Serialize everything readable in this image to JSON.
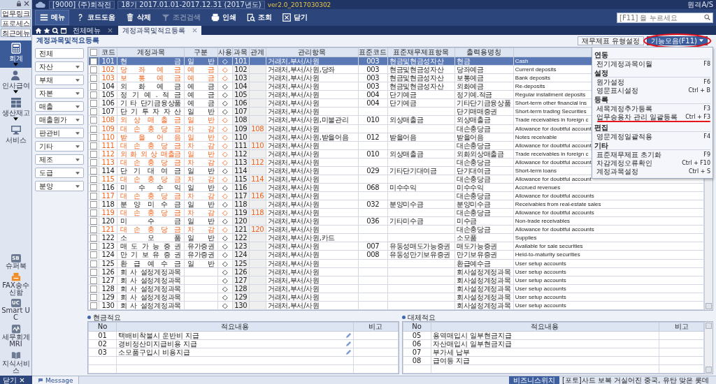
{
  "title_bar": {
    "company": "[9000] (주)회작전",
    "period": "18기 2017.01.01-2017.12.31 (2017년도)",
    "version": "ver2.0_2017030302",
    "remote": "원격A/S"
  },
  "search": {
    "placeholder": "[F11] 을 누르세요"
  },
  "sidebar": {
    "top_buttons": [
      "업무링크",
      "프로세스",
      "최근메뉴"
    ],
    "modules": [
      {
        "kind": "calculator",
        "label": "회계",
        "selected": true,
        "expandable": true
      },
      {
        "kind": "person",
        "label": "인사급여",
        "selected": false,
        "expandable": true
      },
      {
        "kind": "grid",
        "label": "생산재고",
        "selected": false,
        "expandable": true
      },
      {
        "kind": "monitor",
        "label": "서비스",
        "selected": false,
        "expandable": false
      }
    ],
    "shortcuts": [
      {
        "kind": "badge",
        "badge": "SB",
        "label": "슈퍼북"
      },
      {
        "kind": "fax",
        "label": "FAX송수신함"
      },
      {
        "kind": "badge",
        "badge": "UC",
        "label": "Smart UC"
      },
      {
        "kind": "chart",
        "label": "세무회계MRI"
      },
      {
        "kind": "book",
        "label": "지식서비스"
      }
    ],
    "close": "닫기"
  },
  "toolbar": [
    {
      "kind": "menu",
      "label": "메뉴",
      "disabled": false
    },
    {
      "kind": "help",
      "label": "코드도움",
      "disabled": false
    },
    {
      "kind": "delete",
      "label": "삭제",
      "disabled": false
    },
    {
      "kind": "filter",
      "label": "조건검색",
      "disabled": true
    },
    {
      "kind": "print",
      "label": "인쇄",
      "disabled": false
    },
    {
      "kind": "search",
      "label": "조회",
      "disabled": false
    },
    {
      "kind": "close",
      "label": "닫기",
      "disabled": false
    }
  ],
  "tabs": [
    {
      "label": "전체메뉴",
      "selected": false
    },
    {
      "label": "계정과목및적요등록",
      "selected": true
    }
  ],
  "page_title": "계정과목및적요등록",
  "actions": {
    "type_setting": "재무제표 유형설정",
    "functions": "기능모음(F11)",
    "circled": true
  },
  "categories": [
    {
      "label": "전체",
      "expandable": false
    },
    {
      "label": "자산",
      "expandable": true
    },
    {
      "label": "부채",
      "expandable": true
    },
    {
      "label": "자본",
      "expandable": true
    },
    {
      "label": "매출",
      "expandable": true
    },
    {
      "label": "매출원가",
      "expandable": true
    },
    {
      "label": "판관비",
      "expandable": true
    },
    {
      "label": "기타",
      "expandable": true
    },
    {
      "label": "제조",
      "expandable": true
    },
    {
      "label": "도급",
      "expandable": true
    },
    {
      "label": "분양",
      "expandable": true
    }
  ],
  "function_menu": {
    "sections": [
      {
        "title": "연동",
        "items": [
          {
            "label": "전기계정과목이월",
            "shortcut": "F8",
            "marked": false
          }
        ]
      },
      {
        "title": "설정",
        "items": [
          {
            "label": "원가설정",
            "shortcut": "F6",
            "marked": false
          },
          {
            "label": "영문표시설정",
            "shortcut": "Ctrl + B",
            "marked": false
          }
        ]
      },
      {
        "title": "등록",
        "items": [
          {
            "label": "세목계정추가등록",
            "shortcut": "F3",
            "marked": false
          },
          {
            "label": "업무승용차 관리 일괄등록",
            "shortcut": "Ctrl + F3",
            "marked": true
          }
        ]
      },
      {
        "title": "편집",
        "items": [
          {
            "label": "영문계정일괄적용",
            "shortcut": "F4",
            "marked": false
          }
        ]
      },
      {
        "title": "기타",
        "items": [
          {
            "label": "표준재무제표 초기화",
            "shortcut": "F9",
            "marked": false
          },
          {
            "label": "차감계정오류확인",
            "shortcut": "Ctrl + F10",
            "marked": false
          },
          {
            "label": "계정과목설정",
            "shortcut": "Ctrl + S",
            "marked": false
          }
        ]
      }
    ]
  },
  "table": {
    "all_checked": false,
    "columns": [
      "코드",
      "계정과목",
      "구분",
      "사용",
      "과목",
      "관계",
      "관리항목",
      "표준코드",
      "표준재무제표항목",
      "출력용명칭"
    ],
    "rows": [
      {
        "code": "101",
        "name": "현 금",
        "type": "일 반",
        "use": "◇",
        "subject": "101",
        "mgmt": "거래처,부서/사원",
        "std_code": "003",
        "std_item": "현금및현금성자산",
        "print_name": "현금",
        "english": "Cash",
        "highlighted": false,
        "checked": false,
        "selected": true
      },
      {
        "code": "102",
        "name": "당 좌 예 금",
        "type": "예 금",
        "use": "◇",
        "subject": "102",
        "mgmt": "거래처,부서/사원,당좌",
        "std_code": "003",
        "std_item": "현금및현금성자산",
        "print_name": "당좌예금",
        "english": "Current deposits",
        "highlighted": true,
        "checked": false,
        "selected": false
      },
      {
        "code": "103",
        "name": "보 통 예 금",
        "type": "예 금",
        "use": "◇",
        "subject": "103",
        "mgmt": "거래처,부서/사원",
        "std_code": "003",
        "std_item": "현금및현금성자산",
        "print_name": "보통예금",
        "english": "Bank deposits",
        "highlighted": true,
        "checked": false,
        "selected": false
      },
      {
        "code": "104",
        "name": "외 화 예 금",
        "type": "예 금",
        "use": "◇",
        "subject": "104",
        "mgmt": "거래처,부서/사원",
        "std_code": "003",
        "std_item": "현금및현금성자산",
        "print_name": "외화예금",
        "english": "Re-deposits",
        "highlighted": false,
        "checked": false,
        "selected": false
      },
      {
        "code": "105",
        "name": "정 기 예 . 적 금",
        "type": "예 금",
        "use": "◇",
        "subject": "105",
        "mgmt": "거래처,부서/사원",
        "std_code": "004",
        "std_item": "단기예금",
        "print_name": "정기예.적금",
        "english": "Regular installment deposits",
        "highlighted": false,
        "checked": false,
        "selected": false
      },
      {
        "code": "106",
        "name": "기 타 단기금융상품",
        "type": "예 금",
        "use": "◇",
        "subject": "106",
        "mgmt": "거래처,부서/사원",
        "std_code": "004",
        "std_item": "단기예금",
        "print_name": "기타단기금융상품",
        "english": "Short-term other financial ins",
        "highlighted": false,
        "checked": false,
        "selected": false
      },
      {
        "code": "107",
        "name": "단 기 투 자 자 산",
        "type": "일 반",
        "use": "◇",
        "subject": "107",
        "mgmt": "거래처,부서/사원",
        "print_name": "단기매매증권",
        "english": "Short-term trading Securities",
        "highlighted": false,
        "checked": false,
        "selected": false
      },
      {
        "code": "108",
        "name": "외 상 매 출 금",
        "type": "일 반",
        "use": "◇",
        "subject": "108",
        "mgmt": "거래처,부서/사원,미불관리",
        "std_code": "010",
        "std_item": "외상매출금",
        "print_name": "외상매출금",
        "english": "Trade receivables in foreign c",
        "highlighted": true,
        "checked": false,
        "selected": false
      },
      {
        "code": "109",
        "name": "대 손 충 당 금",
        "type": "차 감",
        "use": "◇",
        "subject": "109",
        "relation": "108",
        "mgmt": "거래처,부서/사원",
        "print_name": "대손충당금",
        "english": "Allowance for doubtful account",
        "highlighted": true,
        "checked": false,
        "selected": false
      },
      {
        "code": "110",
        "name": "받 을 어 음",
        "type": "일 반",
        "use": "◇",
        "subject": "110",
        "mgmt": "거래처,부서/사원,받을어음",
        "std_code": "012",
        "std_item": "받을어음",
        "print_name": "받을어음",
        "english": "Notes receivable",
        "highlighted": true,
        "checked": false,
        "selected": false
      },
      {
        "code": "111",
        "name": "대 손 충 당 금",
        "type": "차 감",
        "use": "◇",
        "subject": "111",
        "relation": "110",
        "mgmt": "거래처,부서/사원",
        "print_name": "대손충당금",
        "english": "Allowance for doubtful account",
        "highlighted": true,
        "checked": false,
        "selected": false
      },
      {
        "code": "112",
        "name": "외 화 외 상 매출금",
        "type": "일 반",
        "use": "◇",
        "subject": "112",
        "mgmt": "거래처,부서/사원",
        "std_code": "010",
        "std_item": "외상매출금",
        "print_name": "외화외상매출금",
        "english": "Trade receivables in foreign c",
        "highlighted": true,
        "checked": false,
        "selected": false
      },
      {
        "code": "113",
        "name": "대 손 충 당 금",
        "type": "차 감",
        "use": "◇",
        "subject": "113",
        "relation": "112",
        "mgmt": "거래처,부서/사원",
        "print_name": "대손충당금",
        "english": "Allowance for doubtful account",
        "highlighted": true,
        "checked": false,
        "selected": false
      },
      {
        "code": "114",
        "name": "단 기 대 여 금",
        "type": "일 반",
        "use": "◇",
        "subject": "114",
        "mgmt": "거래처,부서/사원",
        "std_code": "029",
        "std_item": "기타단기대여금",
        "print_name": "단기대여금",
        "english": "Short-term loans",
        "highlighted": false,
        "checked": false,
        "selected": false
      },
      {
        "code": "115",
        "name": "대 손 충 당 금",
        "type": "차 감",
        "use": "◇",
        "subject": "115",
        "relation": "114",
        "mgmt": "거래처,부서/사원",
        "print_name": "대손충당금",
        "english": "Allowance for doubtful account",
        "highlighted": true,
        "checked": false,
        "selected": false
      },
      {
        "code": "116",
        "name": "미 수 수 익",
        "type": "일 반",
        "use": "◇",
        "subject": "116",
        "mgmt": "거래처,부서/사원",
        "std_code": "068",
        "std_item": "미수수익",
        "print_name": "미수수익",
        "english": "Accrued revenues",
        "highlighted": false,
        "checked": false,
        "selected": false
      },
      {
        "code": "117",
        "name": "대 손 충 당 금",
        "type": "차 감",
        "use": "◇",
        "subject": "117",
        "relation": "116",
        "mgmt": "거래처,부서/사원",
        "print_name": "대손충당금",
        "english": "Allowance for doubtful accounts",
        "highlighted": true,
        "checked": false,
        "selected": false
      },
      {
        "code": "118",
        "name": "분 양 미 수 금",
        "type": "일 반",
        "use": "◇",
        "subject": "118",
        "mgmt": "거래처,부서/사원",
        "std_code": "032",
        "std_item": "분양미수금",
        "print_name": "분양미수금",
        "english": "Receivables from real-estate sales",
        "highlighted": false,
        "checked": false,
        "selected": false
      },
      {
        "code": "119",
        "name": "대 손 충 당 금",
        "type": "차 감",
        "use": "◇",
        "subject": "119",
        "relation": "118",
        "mgmt": "거래처,부서/사원",
        "print_name": "대손충당금",
        "english": "Allowance for doubtful accounts",
        "highlighted": true,
        "checked": false,
        "selected": false
      },
      {
        "code": "120",
        "name": "미 수 금",
        "type": "일 반",
        "use": "◇",
        "subject": "120",
        "mgmt": "거래처,부서/사원",
        "std_code": "036",
        "std_item": "기타미수금",
        "print_name": "미수금",
        "english": "Non-trade receivables",
        "highlighted": false,
        "checked": false,
        "selected": false
      },
      {
        "code": "121",
        "name": "대 손 충 당 금",
        "type": "차 감",
        "use": "◇",
        "subject": "121",
        "relation": "120",
        "mgmt": "거래처,부서/사원",
        "print_name": "대손충당금",
        "english": "Allowance for doubtful accounts",
        "highlighted": true,
        "checked": false,
        "selected": false
      },
      {
        "code": "122",
        "name": "소 모 품",
        "type": "일 반",
        "use": "◇",
        "subject": "122",
        "mgmt": "거래처,부서/사원,카드",
        "print_name": "소모품",
        "english": "Supplies",
        "highlighted": false,
        "checked": false,
        "selected": false
      },
      {
        "code": "123",
        "name": "매 도 가 능 증 권",
        "type": "유가증권",
        "use": "◇",
        "subject": "123",
        "mgmt": "거래처,부서/사원",
        "std_code": "007",
        "std_item": "유동성매도가능증권",
        "print_name": "매도가능증권",
        "english": "Available for sale securities",
        "highlighted": false,
        "checked": false,
        "selected": false
      },
      {
        "code": "124",
        "name": "만 기 보 유 증 권",
        "type": "유가증권",
        "use": "◇",
        "subject": "124",
        "mgmt": "거래처,부서/사원",
        "std_code": "008",
        "std_item": "유동성만기보유증권",
        "print_name": "만기보유증권",
        "english": "Held-to-maturity securities",
        "highlighted": false,
        "checked": false,
        "selected": false
      },
      {
        "code": "125",
        "name": "환 급 예 수 금",
        "type": "일 반",
        "use": "◇",
        "subject": "125",
        "mgmt": "거래처,부서/사원",
        "print_name": "환급예수금",
        "english": "User setup accounts",
        "highlighted": false,
        "checked": false,
        "selected": false
      },
      {
        "code": "126",
        "name": "회 사 설정계정과목",
        "use": "◇",
        "subject": "126",
        "mgmt": "거래처,부서/사원",
        "print_name": "회사설정계정과목",
        "english": "User setup accounts",
        "highlighted": false,
        "checked": false,
        "selected": false
      },
      {
        "code": "127",
        "name": "회 사 설정계정과목",
        "use": "◇",
        "subject": "127",
        "mgmt": "거래처,부서/사원",
        "print_name": "회사설정계정과목",
        "english": "User setup accounts",
        "highlighted": false,
        "checked": false,
        "selected": false
      },
      {
        "code": "128",
        "name": "회 사 설정계정과목",
        "use": "◇",
        "subject": "128",
        "mgmt": "거래처,부서/사원",
        "print_name": "회사설정계정과목",
        "english": "User setup accounts",
        "highlighted": false,
        "checked": false,
        "selected": false
      },
      {
        "code": "129",
        "name": "회 사 설정계정과목",
        "use": "◇",
        "subject": "129",
        "mgmt": "거래처,부서/사원",
        "print_name": "회사설정계정과목",
        "english": "User setup accounts",
        "highlighted": false,
        "checked": false,
        "selected": false
      },
      {
        "code": "130",
        "name": "회 사 설정계정과목",
        "use": "◇",
        "subject": "130",
        "mgmt": "거래처,부서/사원",
        "print_name": "회사설정계정과목",
        "english": "User setup accounts",
        "highlighted": false,
        "checked": false,
        "selected": false
      }
    ]
  },
  "memo_panels": [
    {
      "title": "현금적요",
      "columns": [
        "No",
        "적요내용",
        "비고"
      ],
      "rows": [
        {
          "no": "01",
          "text": "택배비착불시 운반비 지급",
          "editable": true
        },
        {
          "no": "02",
          "text": "경비정산미지급비용 지급",
          "editable": true
        },
        {
          "no": "03",
          "text": "소모품구입시 비용지급",
          "editable": true
        }
      ]
    },
    {
      "title": "대체적요",
      "columns": [
        "No",
        "적요내용",
        "비고"
      ],
      "rows": [
        {
          "no": "05",
          "text": "용역매입시 일부현금지급",
          "editable": false
        },
        {
          "no": "06",
          "text": "자산매입시 일부현금지급",
          "editable": false
        },
        {
          "no": "07",
          "text": "부가세 납부",
          "editable": false
        },
        {
          "no": "08",
          "text": "급여등 지급",
          "editable": false
        }
      ]
    }
  ],
  "status_bar": {
    "message_tab": "Message",
    "news_source": "비즈니스위치",
    "news": "[포토]사드 보복 거실어진 중국, 유탄 맞은 롯데"
  }
}
